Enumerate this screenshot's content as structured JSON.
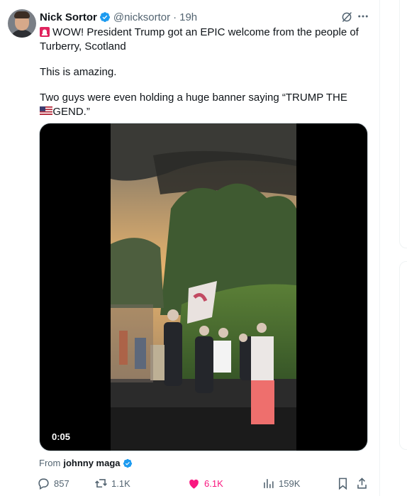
{
  "author": {
    "name": "Nick Sortor",
    "handle": "@nicksortor",
    "separator": "·",
    "time": "19h"
  },
  "post": {
    "line1": "WOW! President Trump got an EPIC welcome from the people of",
    "line2": "Turberry, Scotland",
    "line3": "This is amazing.",
    "line4": "Two guys were even holding a huge banner saying “TRUMP THE LEGEND.”"
  },
  "media": {
    "duration": "0:05"
  },
  "attribution": {
    "prefix": "From",
    "source": "johnny maga"
  },
  "metrics": {
    "replies": "857",
    "reposts": "1.1K",
    "likes": "6.1K",
    "views": "159K"
  },
  "colors": {
    "like_active": "#f91880",
    "verified": "#1d9bf0",
    "secondary_text": "#536471"
  },
  "icons": [
    "verified-badge-icon",
    "grok-icon",
    "more-icon",
    "alert-siren-icon",
    "us-flag-icon",
    "reply-icon",
    "repost-icon",
    "like-icon",
    "views-icon",
    "bookmark-icon",
    "share-icon"
  ]
}
